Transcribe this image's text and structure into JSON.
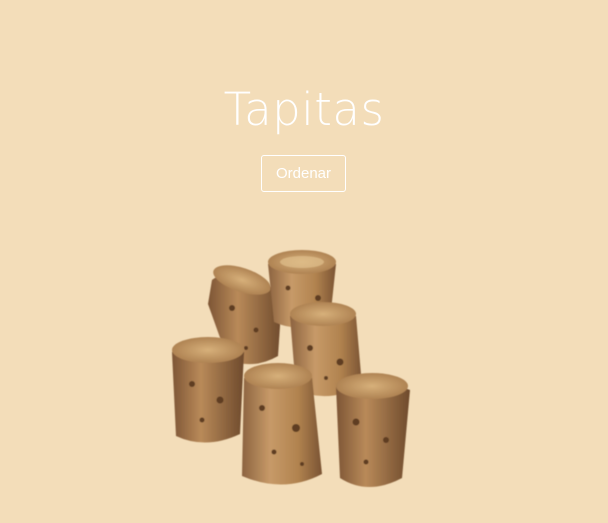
{
  "hero": {
    "title": "Tapitas",
    "button_label": "Ordenar"
  },
  "colors": {
    "background": "#f3ddb9",
    "text": "#ffffff",
    "product_base": "#b88a5a"
  },
  "product": {
    "icon": "dog-treat-cork-pieces"
  }
}
